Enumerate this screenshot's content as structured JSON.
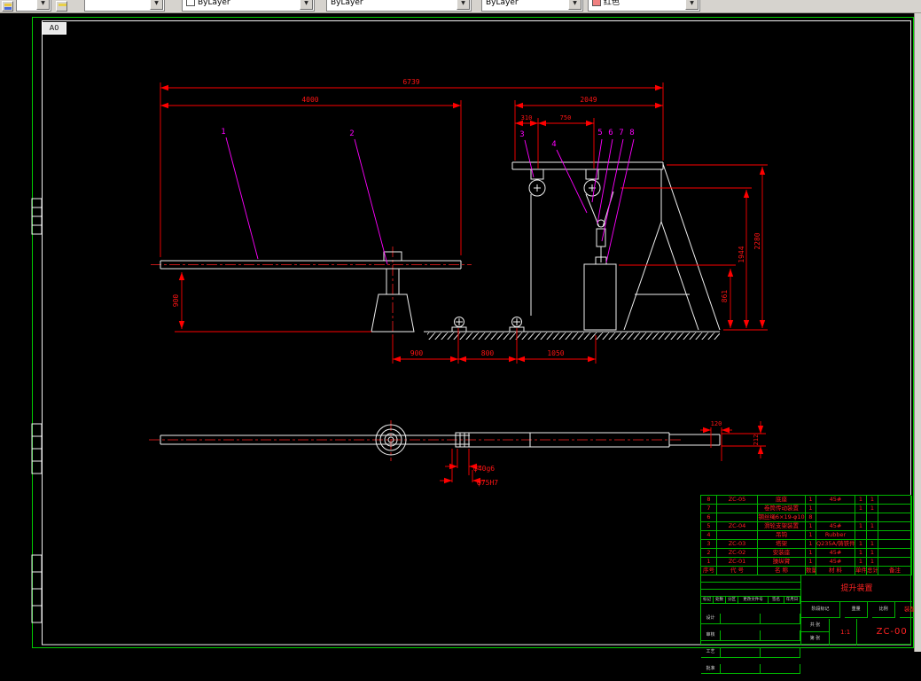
{
  "toolbar": {
    "layer_value": "",
    "color_value": "ByLayer",
    "linetype_value": "ByLayer",
    "lineweight_value": "ByLayer",
    "plotstyle_value": "红色"
  },
  "frame": {
    "size_label": "A0"
  },
  "dims": {
    "total": "6739",
    "left_span": "4000",
    "right_span": "2049",
    "d310": "310",
    "d750": "750",
    "h900": "900",
    "b900": "900",
    "b800": "800",
    "b1050": "1050",
    "v2280": "2280",
    "v1944": "1944",
    "v861": "861",
    "s120": "120",
    "s212": "212",
    "dia40": "φ40g6",
    "dia75": "φ75H7"
  },
  "callouts": [
    "1",
    "2",
    "3",
    "4",
    "5",
    "6",
    "7",
    "8"
  ],
  "titleblock": {
    "parts_columns": [
      "序号",
      "代 号",
      "名 称",
      "数量",
      "材 料",
      "单件",
      "总计",
      "备注"
    ],
    "parts": [
      {
        "seq": "8",
        "code": "ZC-05",
        "name": "底座",
        "qty": "1",
        "material": "45#",
        "w1": "1",
        "w2": "1",
        "note": ""
      },
      {
        "seq": "7",
        "code": "",
        "name": "卷筒传动装置",
        "qty": "1",
        "material": "",
        "w1": "1",
        "w2": "1",
        "note": ""
      },
      {
        "seq": "6",
        "code": "",
        "name": "钢丝绳6×19-φ10",
        "qty": "8",
        "material": "",
        "w1": "",
        "w2": "",
        "note": ""
      },
      {
        "seq": "5",
        "code": "ZC-04",
        "name": "滑轮支架装置",
        "qty": "1",
        "material": "45#",
        "w1": "1",
        "w2": "1",
        "note": ""
      },
      {
        "seq": "4",
        "code": "",
        "name": "吊钩",
        "qty": "1",
        "material": "Rubber",
        "w1": "",
        "w2": "",
        "note": ""
      },
      {
        "seq": "3",
        "code": "ZC-03",
        "name": "塔架",
        "qty": "1",
        "material": "Q235A/铸铁件",
        "w1": "1",
        "w2": "1",
        "note": ""
      },
      {
        "seq": "2",
        "code": "ZC-02",
        "name": "安装座",
        "qty": "1",
        "material": "45#",
        "w1": "1",
        "w2": "1",
        "note": ""
      },
      {
        "seq": "1",
        "code": "ZC-01",
        "name": "操纵臂",
        "qty": "1",
        "material": "45#",
        "w1": "1",
        "w2": "1",
        "note": ""
      }
    ],
    "rev_labels": [
      "标记",
      "处数",
      "分区",
      "更改文件号",
      "签名",
      "年月日"
    ],
    "sig_labels": [
      "设计",
      "审核",
      "工艺",
      "批准"
    ],
    "stage_labels": [
      "阶段标记",
      "重量",
      "比例"
    ],
    "drawing_type": "装配图",
    "title_name": "提升装置",
    "scale_value": "1:1",
    "sheet_line1": "共 张",
    "sheet_line2": "第 张",
    "drawing_no": "ZC-00"
  }
}
